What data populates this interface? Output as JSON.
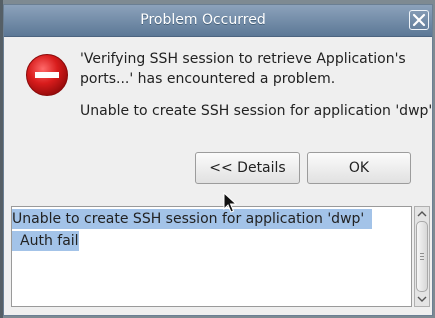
{
  "dialog": {
    "title": "Problem Occurred",
    "message_lines": [
      "'Verifying SSH session to retrieve Application's",
      "ports...' has encountered a problem."
    ],
    "reason": "Unable to create SSH session for application 'dwp'",
    "buttons": {
      "details": "<< Details",
      "ok": "OK"
    },
    "details_lines": [
      "Unable to create SSH session for application 'dwp'",
      "Auth fail"
    ]
  },
  "icons": {
    "error": "error-icon",
    "close": "close-icon"
  },
  "colors": {
    "titlebar": "#6f89a6",
    "selection": "#a3c3e8",
    "error_red": "#d01a1a"
  }
}
